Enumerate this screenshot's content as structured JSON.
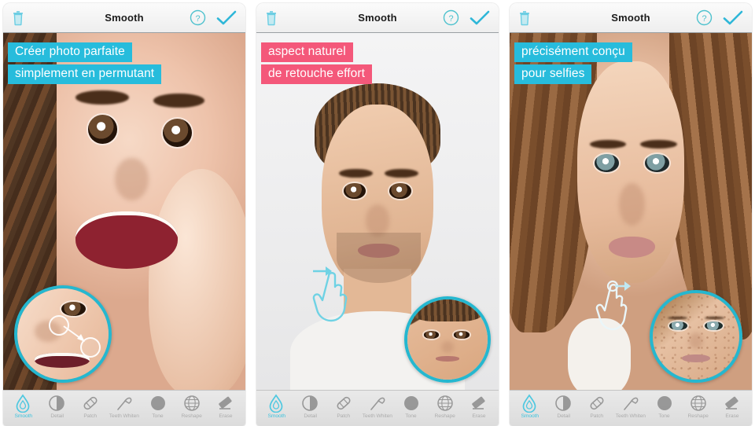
{
  "app": {
    "accent_cyan": "#27bcdc",
    "accent_pink": "#f4587a",
    "loupe_border": "#25b7cf"
  },
  "header": {
    "title": "Smooth",
    "trash_icon": "trash-icon",
    "help_icon": "help-icon",
    "confirm_icon": "checkmark-icon"
  },
  "toolbar": {
    "items": [
      {
        "label": "Smooth",
        "icon": "droplet-icon",
        "active": true
      },
      {
        "label": "Detail",
        "icon": "contrast-icon",
        "active": false
      },
      {
        "label": "Patch",
        "icon": "bandage-icon",
        "active": false
      },
      {
        "label": "Teeth Whiten",
        "icon": "toothbrush-icon",
        "active": false
      },
      {
        "label": "Tone",
        "icon": "circle-icon",
        "active": false
      },
      {
        "label": "Reshape",
        "icon": "mesh-globe-icon",
        "active": false
      },
      {
        "label": "Erase",
        "icon": "eraser-icon",
        "active": false
      }
    ]
  },
  "panels": [
    {
      "name": "panel-one",
      "caption_color": "cyan",
      "captions": [
        "Créer photo parfaite",
        "simplement en permutant"
      ],
      "loupe": "clone-preview-loupe"
    },
    {
      "name": "panel-two",
      "caption_color": "pink",
      "captions": [
        "aspect naturel",
        "de retouche effort"
      ],
      "loupe": "smooth-preview-loupe"
    },
    {
      "name": "panel-three",
      "caption_color": "cyan",
      "captions": [
        "précisément conçu",
        "pour selfies"
      ],
      "loupe": "blemish-preview-loupe"
    }
  ]
}
